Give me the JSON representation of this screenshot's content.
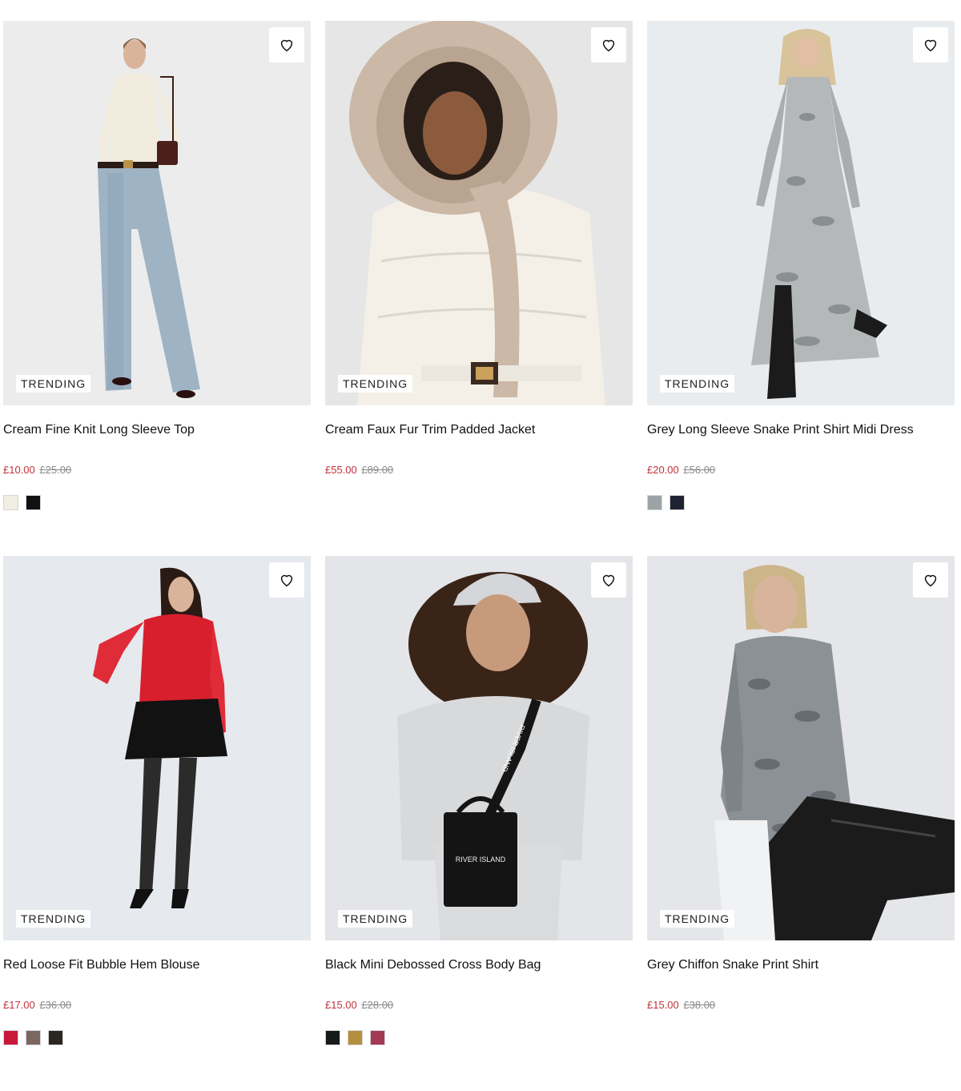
{
  "products": [
    {
      "badge": "TRENDING",
      "title": "Cream Fine Knit Long Sleeve Top",
      "price_now": "£10.00",
      "price_was": "£25.00",
      "image_bg": "#ececec",
      "swatches": [
        {
          "name": "cream",
          "color": "#efeee0"
        },
        {
          "name": "black",
          "color": "#111111"
        }
      ]
    },
    {
      "badge": "TRENDING",
      "title": "Cream Faux Fur Trim Padded Jacket",
      "price_now": "£55.00",
      "price_was": "£89.00",
      "image_bg": "#e6e6e6",
      "swatches": []
    },
    {
      "badge": "TRENDING",
      "title": "Grey Long Sleeve Snake Print Shirt Midi Dress",
      "price_now": "£20.00",
      "price_was": "£56.00",
      "image_bg": "#e9ecee",
      "swatches": [
        {
          "name": "grey-snake",
          "color": "#9ea3a6"
        },
        {
          "name": "black-print",
          "color": "#1f2230"
        }
      ]
    },
    {
      "badge": "TRENDING",
      "title": "Red Loose Fit Bubble Hem Blouse",
      "price_now": "£17.00",
      "price_was": "£36.00",
      "image_bg": "#e6e9ed",
      "swatches": [
        {
          "name": "red",
          "color": "#c8193a"
        },
        {
          "name": "brown",
          "color": "#7b6660"
        },
        {
          "name": "black-floral",
          "color": "#2b2620"
        }
      ]
    },
    {
      "badge": "TRENDING",
      "title": "Black Mini Debossed Cross Body Bag",
      "price_now": "£15.00",
      "price_was": "£28.00",
      "image_bg": "#e3e5e8",
      "swatches": [
        {
          "name": "black",
          "color": "#161a1a"
        },
        {
          "name": "tan",
          "color": "#b4903e"
        },
        {
          "name": "berry",
          "color": "#a33a55"
        }
      ]
    },
    {
      "badge": "TRENDING",
      "title": "Grey Chiffon Snake Print Shirt",
      "price_now": "£15.00",
      "price_was": "£38.00",
      "image_bg": "#e4e6e9",
      "swatches": []
    }
  ],
  "bag_logo_text": "RIVER ISLAND",
  "strap_text": "RIVER ISLAND"
}
